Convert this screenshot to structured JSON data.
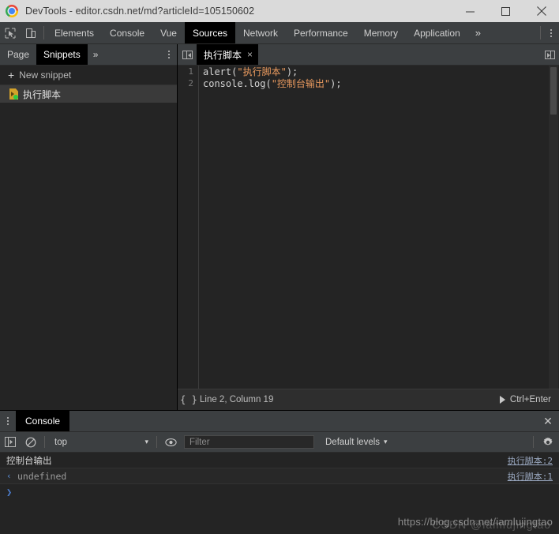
{
  "window": {
    "title": "DevTools - editor.csdn.net/md?articleId=105150602",
    "controls": {
      "minimize": "minimize-icon",
      "maximize": "maximize-icon",
      "close": "close-icon"
    },
    "app_icon": "chrome-logo-icon"
  },
  "devtools_tabbar": {
    "inspect_icon": "inspect-element-icon",
    "device_icon": "device-toolbar-icon",
    "tabs": [
      {
        "label": "Elements",
        "active": false
      },
      {
        "label": "Console",
        "active": false
      },
      {
        "label": "Vue",
        "active": false
      },
      {
        "label": "Sources",
        "active": true
      },
      {
        "label": "Network",
        "active": false
      },
      {
        "label": "Performance",
        "active": false
      },
      {
        "label": "Memory",
        "active": false
      },
      {
        "label": "Application",
        "active": false
      }
    ],
    "more_label": "»",
    "menu_icon": "kebab-menu-icon"
  },
  "navigator": {
    "tabs": [
      {
        "label": "Page",
        "active": false
      },
      {
        "label": "Snippets",
        "active": true
      }
    ],
    "more_label": "»",
    "menu_icon": "kebab-menu-icon",
    "new_snippet_label": "New snippet",
    "new_snippet_plus": "+",
    "snippets": [
      {
        "name": "执行脚本",
        "icon": "snippet-file-icon",
        "selected": true,
        "running_badge": true
      }
    ]
  },
  "editor": {
    "show_navigator_icon": "show-navigator-icon",
    "show_sidebar_icon": "show-sidebar-icon",
    "tab": {
      "label": "执行脚本",
      "close_label": "×"
    },
    "lines": [
      {
        "number": "1",
        "tokens": [
          {
            "text": "alert(",
            "type": "plain"
          },
          {
            "text": "\"执行脚本\"",
            "type": "string"
          },
          {
            "text": ");",
            "type": "plain"
          }
        ]
      },
      {
        "number": "2",
        "tokens": [
          {
            "text": "console.log(",
            "type": "plain"
          },
          {
            "text": "\"控制台输出\"",
            "type": "string"
          },
          {
            "text": ");",
            "type": "plain"
          }
        ]
      }
    ],
    "status": {
      "format_icon": "{ }",
      "position": "Line 2, Column 19",
      "run_icon": "play-icon",
      "run_shortcut": "Ctrl+Enter"
    }
  },
  "drawer": {
    "menu_icon": "kebab-menu-icon",
    "tab_label": "Console",
    "close_label": "✕",
    "toolbar": {
      "sidebar_icon": "console-sidebar-icon",
      "clear_icon": "clear-console-icon",
      "context": "top",
      "context_caret": "▾",
      "eye_icon": "live-expression-icon",
      "filter_placeholder": "Filter",
      "filter_value": "",
      "levels_label": "Default levels",
      "levels_caret": "▾",
      "settings_icon": "gear-icon"
    },
    "messages": [
      {
        "kind": "log",
        "arrow": "",
        "text": "控制台输出",
        "source": "执行脚本:2"
      },
      {
        "kind": "result",
        "arrow": "‹",
        "text": "undefined",
        "source": "执行脚本:1"
      }
    ],
    "prompt_caret": "❯"
  },
  "watermark": {
    "url": "https://blog.csdn.net/iamlujingtao",
    "stamp": "CSDN @iamlujingtao"
  },
  "colors": {
    "accent_active_tab": "#000000",
    "toolbar_bg": "#3c3f41",
    "editor_bg": "#242424",
    "string_token": "#e8995e",
    "link": "#9aa8c0",
    "snippet_badge": "#2ecc40"
  }
}
